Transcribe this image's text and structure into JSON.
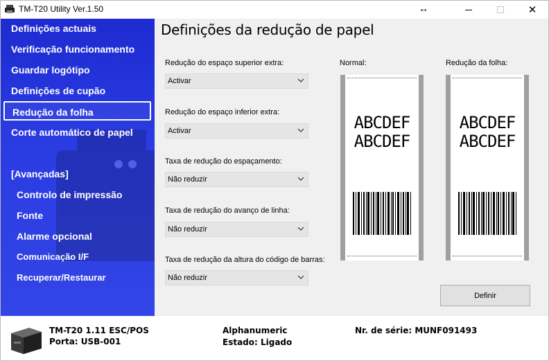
{
  "window": {
    "title": "TM-T20 Utility Ver.1.50"
  },
  "sidebar": {
    "items": [
      {
        "label": "Definições actuais"
      },
      {
        "label": "Verificação funcionamento"
      },
      {
        "label": "Guardar logótipo"
      },
      {
        "label": "Definições de cupão"
      },
      {
        "label": "Redução da folha",
        "selected": true
      },
      {
        "label": "Corte automático de papel"
      }
    ],
    "advanced_header": "[Avançadas]",
    "advanced_items": [
      {
        "label": "Controlo de impressão"
      },
      {
        "label": "Fonte"
      },
      {
        "label": "Alarme opcional"
      },
      {
        "label": "Comunicação I/F"
      },
      {
        "label": "Recuperar/Restaurar"
      }
    ]
  },
  "main": {
    "title": "Definições da redução de papel",
    "fields": [
      {
        "label": "Redução do espaço superior extra:",
        "value": "Activar"
      },
      {
        "label": "Redução do espaço inferior extra:",
        "value": "Activar"
      },
      {
        "label": "Taxa de redução do espaçamento:",
        "value": "Não reduzir"
      },
      {
        "label": "Taxa de redução do avanço de linha:",
        "value": "Não reduzir"
      },
      {
        "label": "Taxa de redução da altura do código de barras:",
        "value": "Não reduzir"
      }
    ],
    "preview": {
      "normal_label": "Normal:",
      "reduced_label": "Redução da folha:",
      "sample_line1": "ABCDEF",
      "sample_line2": "ABCDEF"
    },
    "define_button": "Definir"
  },
  "status": {
    "model": "TM-T20 1.11 ESC/POS",
    "port": "Porta: USB-001",
    "font_mode": "Alphanumeric",
    "state": "Estado: Ligado",
    "serial": "Nr. de série: MUNF091493"
  },
  "colors": {
    "sidebar_top": "#1d2bd0",
    "sidebar_bottom": "#3345e6",
    "panel_bg": "#f0f0f0"
  }
}
